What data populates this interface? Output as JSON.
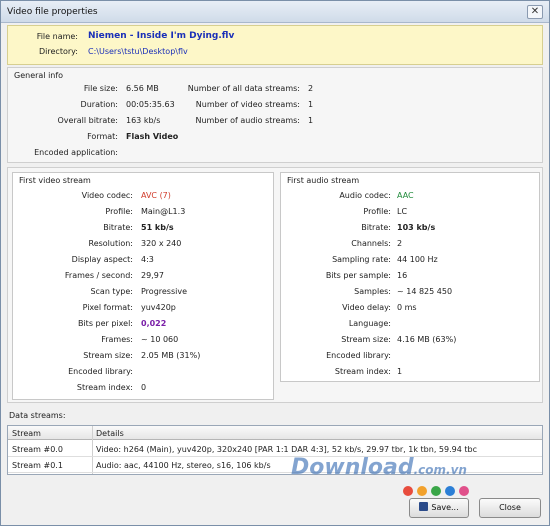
{
  "window": {
    "title": "Video file properties",
    "close_glyph": "✕"
  },
  "file": {
    "name_label": "File name:",
    "name_value": "Niemen - Inside I'm Dying.flv",
    "dir_label": "Directory:",
    "dir_value": "C:\\Users\\tstu\\Desktop\\flv"
  },
  "general": {
    "legend": "General info",
    "left": [
      {
        "label": "File size:",
        "value": "6.56 MB"
      },
      {
        "label": "Duration:",
        "value": "00:05:35.63"
      },
      {
        "label": "Overall bitrate:",
        "value": "163 kb/s"
      },
      {
        "label": "Format:",
        "value": "Flash Video"
      },
      {
        "label": "Encoded application:",
        "value": ""
      }
    ],
    "right": [
      {
        "label": "Number of all data streams:",
        "value": "2"
      },
      {
        "label": "Number of video streams:",
        "value": "1"
      },
      {
        "label": "Number of audio streams:",
        "value": "1"
      }
    ]
  },
  "video": {
    "legend": "First video stream",
    "rows": [
      {
        "label": "Video codec:",
        "value": "AVC (7)"
      },
      {
        "label": "Profile:",
        "value": "Main@L1.3"
      },
      {
        "label": "Bitrate:",
        "value": "51 kb/s"
      },
      {
        "label": "Resolution:",
        "value": "320 x 240"
      },
      {
        "label": "Display aspect:",
        "value": "4:3"
      },
      {
        "label": "Frames / second:",
        "value": "29,97"
      },
      {
        "label": "Scan type:",
        "value": "Progressive"
      },
      {
        "label": "Pixel format:",
        "value": "yuv420p"
      },
      {
        "label": "Bits per pixel:",
        "value": "0,022"
      },
      {
        "label": "Frames:",
        "value": "~ 10 060"
      },
      {
        "label": "Stream size:",
        "value": "2.05 MB (31%)"
      },
      {
        "label": "Encoded library:",
        "value": ""
      },
      {
        "label": "Stream index:",
        "value": "0"
      }
    ]
  },
  "audio": {
    "legend": "First audio stream",
    "rows": [
      {
        "label": "Audio codec:",
        "value": "AAC"
      },
      {
        "label": "Profile:",
        "value": "LC"
      },
      {
        "label": "Bitrate:",
        "value": "103 kb/s"
      },
      {
        "label": "Channels:",
        "value": "2"
      },
      {
        "label": "Sampling rate:",
        "value": "44 100 Hz"
      },
      {
        "label": "Bits per sample:",
        "value": "16"
      },
      {
        "label": "Samples:",
        "value": "~ 14 825 450"
      },
      {
        "label": "Video delay:",
        "value": "0 ms"
      },
      {
        "label": "Language:",
        "value": ""
      },
      {
        "label": "Stream size:",
        "value": "4.16 MB (63%)"
      },
      {
        "label": "Encoded library:",
        "value": ""
      },
      {
        "label": "Stream index:",
        "value": "1"
      }
    ]
  },
  "streams": {
    "heading": "Data streams:",
    "columns": [
      "Stream",
      "Details"
    ],
    "rows": [
      {
        "stream": "Stream #0.0",
        "details": "Video: h264 (Main), yuv420p, 320x240 [PAR 1:1 DAR 4:3], 52 kb/s, 29.97 tbr, 1k tbn, 59.94 tbc"
      },
      {
        "stream": "Stream #0.1",
        "details": "Audio: aac, 44100 Hz, stereo, s16, 106 kb/s"
      }
    ]
  },
  "watermark": {
    "main": "Download",
    "suffix": ".com.vn"
  },
  "buttons": {
    "save": "Save...",
    "close": "Close"
  },
  "colors": {
    "accent_blue": "#1a2fb8",
    "codec_red": "#d03a2a",
    "codec_green": "#1f8a3a",
    "bits_purple": "#7a1fa8"
  }
}
